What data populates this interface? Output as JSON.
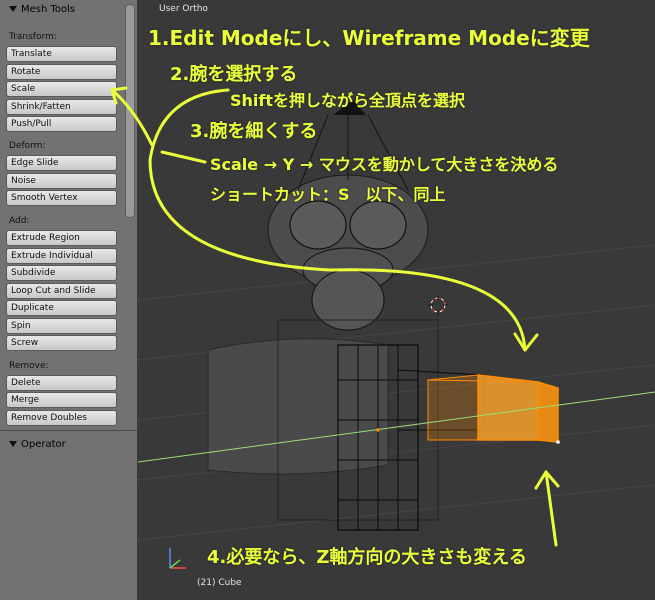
{
  "panel": {
    "header": "Mesh Tools",
    "sections": [
      {
        "label": "Transform:",
        "buttons": [
          "Translate",
          "Rotate",
          "Scale",
          "Shrink/Fatten",
          "Push/Pull"
        ]
      },
      {
        "label": "Deform:",
        "buttons": [
          "Edge Slide",
          "Noise",
          "Smooth Vertex"
        ]
      },
      {
        "label": "Add:",
        "buttons": [
          "Extrude Region",
          "Extrude Individual",
          "Subdivide",
          "Loop Cut and Slide",
          "Duplicate",
          "Spin",
          "Screw"
        ]
      },
      {
        "label": "Remove:",
        "buttons": [
          "Delete",
          "Merge",
          "Remove Doubles"
        ]
      }
    ],
    "operator_header": "Operator"
  },
  "viewport": {
    "view_name": "User Ortho",
    "object_info": "(21) Cube"
  },
  "annotations": {
    "step1": "1.Edit Modeにし、Wireframe Modeに変更",
    "step2": "2.腕を選択する",
    "step2_detail": "Shiftを押しながら全頂点を選択",
    "step3": "3.腕を細くする",
    "step3_detail": "Scale → Y → マウスを動かして大きさを決める",
    "step3_shortcut": "ショートカット：S　以下、同上",
    "step4": "4.必要なら、Z軸方向の大きさも変える"
  },
  "colors": {
    "annotation": "#eaff3a",
    "selection": "#ff8c00",
    "x_axis": "#9be07a",
    "wire": "#0a0a0a"
  }
}
